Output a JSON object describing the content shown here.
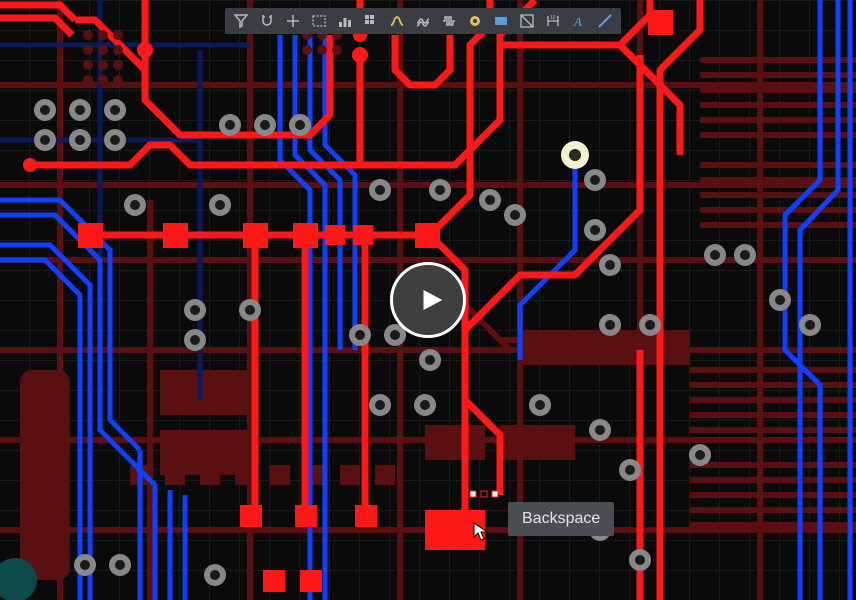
{
  "tooltip": {
    "text": "Backspace"
  },
  "toolbar": {
    "tools": [
      {
        "name": "select-filter",
        "icon": "filter"
      },
      {
        "name": "snap-magnet",
        "icon": "magnet"
      },
      {
        "name": "add-crosshair",
        "icon": "plus"
      },
      {
        "name": "select-rect",
        "icon": "rect"
      },
      {
        "name": "align-distribute",
        "icon": "bars"
      },
      {
        "name": "grid-tool",
        "icon": "grid"
      },
      {
        "name": "route-track",
        "icon": "route"
      },
      {
        "name": "route-diff",
        "icon": "diffpair"
      },
      {
        "name": "tune-length",
        "icon": "tune"
      },
      {
        "name": "add-via",
        "icon": "via"
      },
      {
        "name": "add-zone",
        "icon": "zone"
      },
      {
        "name": "draw-line",
        "icon": "lineshape"
      },
      {
        "name": "add-dimension",
        "icon": "dimension"
      },
      {
        "name": "add-text",
        "icon": "text"
      },
      {
        "name": "draw-segment",
        "icon": "segment"
      }
    ]
  },
  "play": {
    "label": "Play video"
  },
  "colors": {
    "toplayer": "#ff1818",
    "botlayer": "#1040ff",
    "darkred": "#5a1010",
    "darkblue": "#0a1a5a",
    "via_ring": "#888888",
    "via_hole": "#202020",
    "highlight_via": "#f5f0d0"
  }
}
